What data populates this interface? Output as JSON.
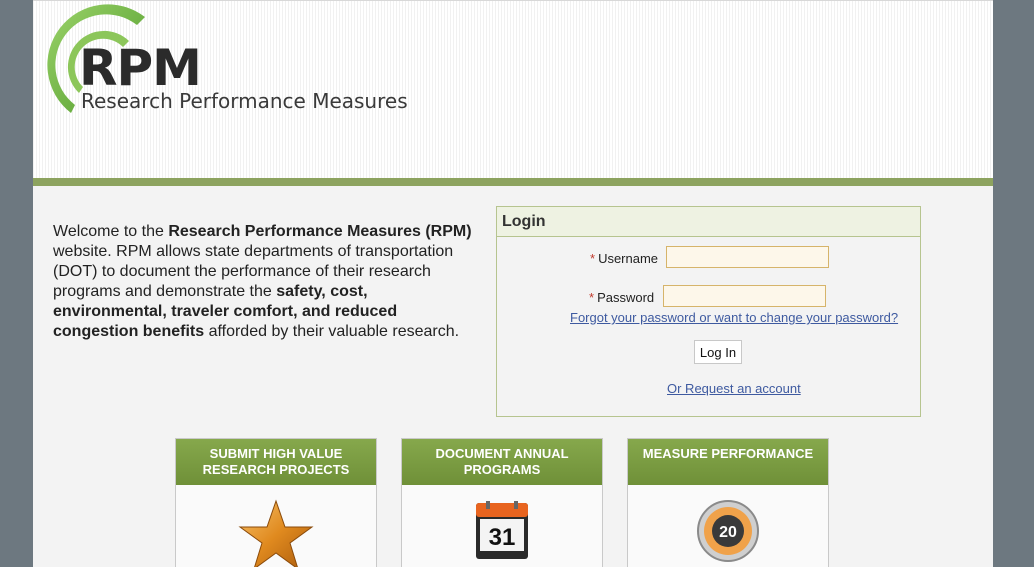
{
  "logo": {
    "mark": "RPM",
    "subtitle": "Research Performance Measures"
  },
  "welcome": {
    "p1": "Welcome to the ",
    "b1": "Research Performance Measures (RPM)",
    "p2": " website. RPM allows state departments of transportation (DOT) to document the performance of their research programs and demonstrate the ",
    "b2": "safety, cost, environmental, traveler comfort, and reduced congestion benefits",
    "p3": " afforded by their valuable research."
  },
  "login": {
    "title": "Login",
    "username_label": "Username",
    "username_value": "",
    "password_label": "Password",
    "password_value": "",
    "required_marker": "*",
    "forgot_link": "Forgot your password or want to change your password?",
    "login_button": "Log In",
    "request_link": "Or Request an account"
  },
  "cards": [
    {
      "title": "SUBMIT HIGH VALUE RESEARCH PROJECTS",
      "icon": "star-icon"
    },
    {
      "title": "DOCUMENT ANNUAL PROGRAMS",
      "icon": "calendar-icon",
      "icon_text": "31"
    },
    {
      "title": "MEASURE PERFORMANCE",
      "icon": "stopwatch-icon",
      "icon_text": "20"
    }
  ],
  "colors": {
    "accent_green": "#789a3f",
    "header_bar": "#8da35f",
    "link": "#3e5aa0",
    "page_bg": "#6d7880"
  }
}
